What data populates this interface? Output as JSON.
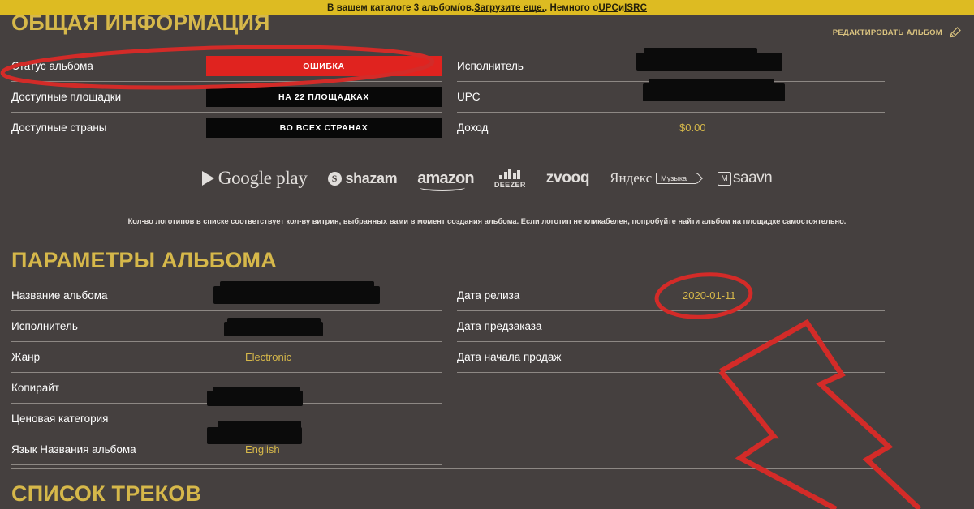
{
  "notice": {
    "text_before": "В вашем каталоге 3 альбом/ов. ",
    "link_upload": "Загрузите еще.",
    "text_mid": ". Немного о ",
    "link_upc": "UPC",
    "text_and": " и ",
    "link_isrc": "ISRC"
  },
  "edit": {
    "label": "РЕДАКТИРОВАТЬ АЛЬБОМ",
    "icon": "pencil-icon"
  },
  "sections": {
    "general": {
      "title": "ОБЩАЯ ИНФОРМАЦИЯ"
    },
    "params": {
      "title": "ПАРАМЕТРЫ АЛЬБОМА"
    },
    "tracks": {
      "title": "СПИСОК ТРЕКОВ"
    }
  },
  "general_left": [
    {
      "label": "Статус альбома",
      "value": "ОШИБКА",
      "style": "error-bar"
    },
    {
      "label": "Доступные площадки",
      "value": "НА 22 ПЛОЩАДКАХ",
      "style": "black-bar"
    },
    {
      "label": "Доступные страны",
      "value": "ВО ВСЕХ СТРАНАХ",
      "style": "black-bar"
    }
  ],
  "general_right": [
    {
      "label": "Исполнитель",
      "value": "",
      "style": "redacted"
    },
    {
      "label": "UPC",
      "value": "",
      "style": "redacted"
    },
    {
      "label": "Доход",
      "value": "$0.00",
      "style": "money"
    }
  ],
  "stores": [
    {
      "name": "google-play",
      "label": "Google play"
    },
    {
      "name": "shazam",
      "label": "shazam"
    },
    {
      "name": "amazon",
      "label": "amazon"
    },
    {
      "name": "deezer",
      "label": "DEEZER"
    },
    {
      "name": "zvooq",
      "label": "zvooq"
    },
    {
      "name": "yandex-muzyka",
      "label": "Яндекс",
      "label2": "Музыка"
    },
    {
      "name": "saavn",
      "label": "saavn"
    }
  ],
  "fineprint": "Кол-во логотипов в списке соответствует кол-ву витрин, выбранных вами в момент создания альбома. Если логотип не кликабелен, попробуйте найти альбом на площадке самостоятельно.",
  "params_left": [
    {
      "label": "Название альбома",
      "value": "",
      "style": "redacted"
    },
    {
      "label": "Исполнитель",
      "value": "",
      "style": "redacted"
    },
    {
      "label": "Жанр",
      "value": "Electronic",
      "style": "text"
    },
    {
      "label": "Копирайт",
      "value": "",
      "style": "redacted"
    },
    {
      "label": "Ценовая категория",
      "value": "",
      "style": "redacted"
    },
    {
      "label": "Язык Названия альбома",
      "value": "English",
      "style": "text"
    }
  ],
  "params_right": [
    {
      "label": "Дата релиза",
      "value": "2020-01-11",
      "style": "date"
    },
    {
      "label": "Дата предзаказа",
      "value": "",
      "style": "empty"
    },
    {
      "label": "Дата начала продаж",
      "value": "",
      "style": "empty"
    }
  ],
  "colors": {
    "background": "#45403F",
    "banner": "#DDBB22",
    "accent_gold": "#D6B84A",
    "status_error": "#E0231F",
    "annotation_red": "#D32B28",
    "redaction": "#0B0B0B",
    "divider": "#8D8884"
  },
  "annotations": [
    {
      "name": "ellipse-album-status",
      "shape": "ellipse"
    },
    {
      "name": "ellipse-release-date",
      "shape": "ellipse"
    },
    {
      "name": "lightning-bolt-arrow",
      "shape": "polyline"
    }
  ]
}
